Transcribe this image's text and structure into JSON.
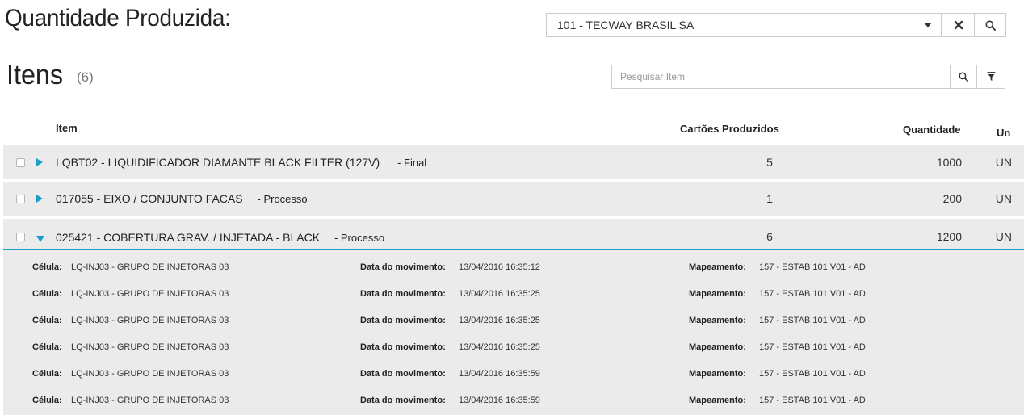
{
  "header": {
    "title": "Quantidade Produzida:",
    "company": "101 - TECWAY BRASIL SA"
  },
  "items_section": {
    "title": "Itens",
    "count": "(6)",
    "search_placeholder": "Pesquisar Item"
  },
  "columns": {
    "item": "Item",
    "cards": "Cartões Produzidos",
    "quantity": "Quantidade",
    "unit": "Un"
  },
  "rows": [
    {
      "name": "LQBT02 - LIQUIDIFICADOR DIAMANTE BLACK FILTER (127V)",
      "type": "- Final",
      "cards": "5",
      "quantity": "1000",
      "unit": "UN",
      "expanded": false
    },
    {
      "name": "017055 - EIXO / CONJUNTO FACAS",
      "type": "- Processo",
      "cards": "1",
      "quantity": "200",
      "unit": "UN",
      "expanded": false
    },
    {
      "name": "025421 - COBERTURA GRAV. / INJETADA - BLACK",
      "type": "- Processo",
      "cards": "6",
      "quantity": "1200",
      "unit": "UN",
      "expanded": true
    }
  ],
  "detail_labels": {
    "cell": "Célula:",
    "date": "Data do movimento:",
    "mapping": "Mapeamento:"
  },
  "details": [
    {
      "cell": "LQ-INJ03 - GRUPO DE INJETORAS 03",
      "date": "13/04/2016 16:35:12",
      "mapping": "157 - ESTAB 101 V01 - AD"
    },
    {
      "cell": "LQ-INJ03 - GRUPO DE INJETORAS 03",
      "date": "13/04/2016 16:35:25",
      "mapping": "157 - ESTAB 101 V01 - AD"
    },
    {
      "cell": "LQ-INJ03 - GRUPO DE INJETORAS 03",
      "date": "13/04/2016 16:35:25",
      "mapping": "157 - ESTAB 101 V01 - AD"
    },
    {
      "cell": "LQ-INJ03 - GRUPO DE INJETORAS 03",
      "date": "13/04/2016 16:35:25",
      "mapping": "157 - ESTAB 101 V01 - AD"
    },
    {
      "cell": "LQ-INJ03 - GRUPO DE INJETORAS 03",
      "date": "13/04/2016 16:35:59",
      "mapping": "157 - ESTAB 101 V01 - AD"
    },
    {
      "cell": "LQ-INJ03 - GRUPO DE INJETORAS 03",
      "date": "13/04/2016 16:35:59",
      "mapping": "157 - ESTAB 101 V01 - AD"
    }
  ],
  "icons": {
    "collapsed_toggle": "triangle-right-icon",
    "expanded_toggle": "triangle-down-icon",
    "clear": "close-icon",
    "search": "search-icon",
    "filter": "filter-icon"
  },
  "colors": {
    "accent": "#1a9ec7",
    "row_bg": "#ebebeb"
  }
}
